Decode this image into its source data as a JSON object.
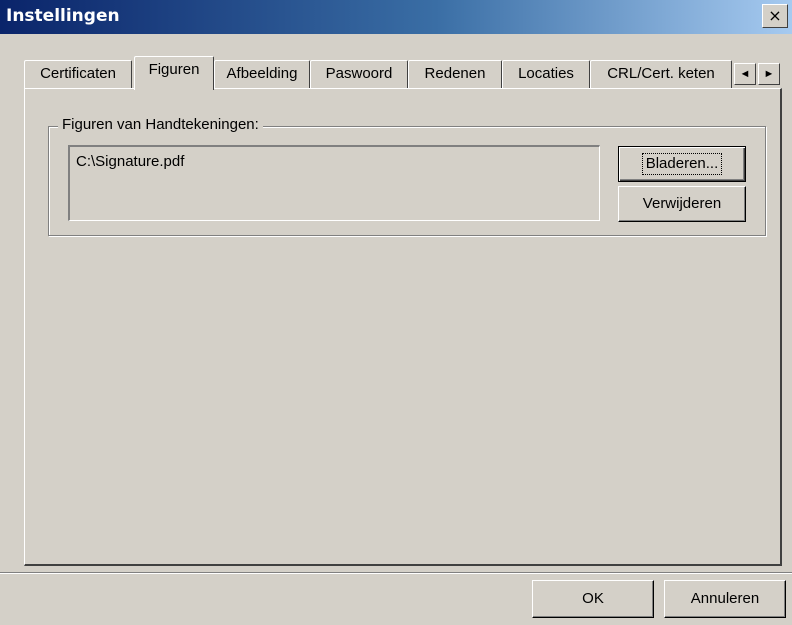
{
  "window": {
    "title": "Instellingen",
    "close_glyph": "×"
  },
  "tabs": [
    {
      "label": "Certificaten"
    },
    {
      "label": "Figuren"
    },
    {
      "label": "Afbeelding"
    },
    {
      "label": "Paswoord"
    },
    {
      "label": "Redenen"
    },
    {
      "label": "Locaties"
    },
    {
      "label": "CRL/Cert. keten"
    }
  ],
  "tab_scroll": {
    "left": "◄",
    "right": "►"
  },
  "group": {
    "label": "Figuren van Handtekeningen:",
    "items": [
      "C:\\Signature.pdf"
    ]
  },
  "buttons": {
    "browse": "Bladeren...",
    "remove": "Verwijderen",
    "ok": "OK",
    "cancel": "Annuleren"
  },
  "colors": {
    "titlebar_start": "#0a246a",
    "titlebar_end": "#a6caf0",
    "face": "#d4d0c8"
  }
}
